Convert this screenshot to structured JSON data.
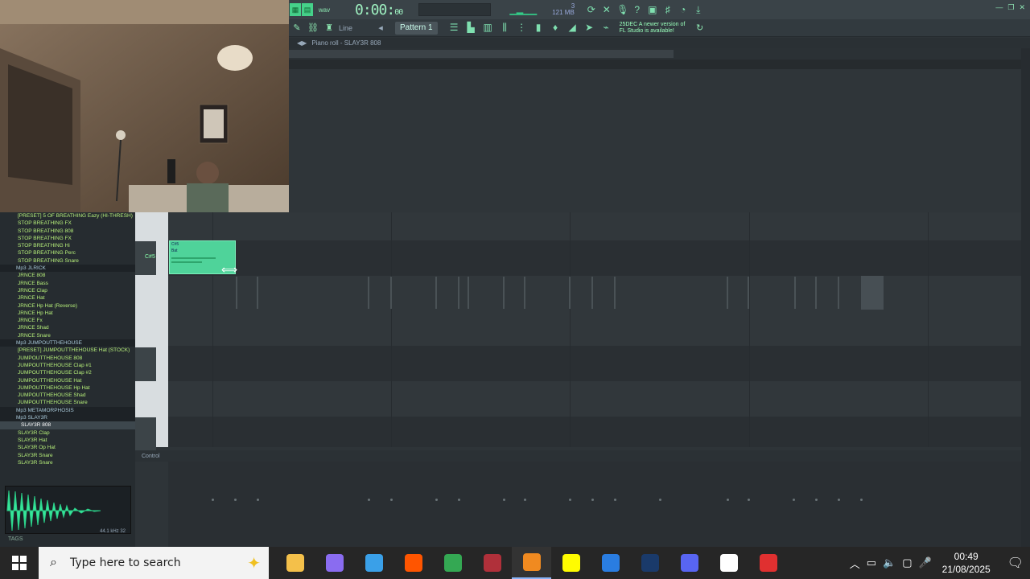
{
  "toolbar": {
    "time_main": "0:00:",
    "time_sub": "00",
    "cpu_line1": "3",
    "cpu_line2": "121 MB",
    "pattern_label": "Pattern 1",
    "snap_label": "Line",
    "hint_line1": "25DEC A newer version of",
    "hint_line2": "FL Studio is available!"
  },
  "piano_roll": {
    "title": "Piano roll - SLAY3R 808",
    "key_label": "C#5",
    "note_label1": "C#5",
    "note_label2": "Bat",
    "control_label": "Control"
  },
  "browser": {
    "items": [
      {
        "label": "[PRESET] 5 OF BREATHING Eazy (HI-THRESH)",
        "kind": "item"
      },
      {
        "label": "STOP BREATHING FX",
        "kind": "item"
      },
      {
        "label": "STOP BREATHING 808",
        "kind": "item"
      },
      {
        "label": "STOP BREATHING FX",
        "kind": "item"
      },
      {
        "label": "STOP BREATHING Hi",
        "kind": "item"
      },
      {
        "label": "STOP BREATHING Perc",
        "kind": "item"
      },
      {
        "label": "STOP BREATHING Snare",
        "kind": "item"
      },
      {
        "label": "Mp3 JLRICK",
        "kind": "folder"
      },
      {
        "label": "JRNCE 808",
        "kind": "item"
      },
      {
        "label": "JRNCE Bass",
        "kind": "item"
      },
      {
        "label": "JRNCE Clap",
        "kind": "item"
      },
      {
        "label": "JRNCE Hat",
        "kind": "item"
      },
      {
        "label": "JRNCE Hp Hat (Reverse)",
        "kind": "item"
      },
      {
        "label": "JRNCE Hp Hat",
        "kind": "item"
      },
      {
        "label": "JRNCE Fx",
        "kind": "item"
      },
      {
        "label": "JRNCE Shad",
        "kind": "item"
      },
      {
        "label": "JRNCE Snare",
        "kind": "item"
      },
      {
        "label": "Mp3 JUMPOUTTHEHOUSE",
        "kind": "folder"
      },
      {
        "label": "[PRESET] JUMPOUTTHEHOUSE Hat (STOCK)",
        "kind": "item"
      },
      {
        "label": "JUMPOUTTHEHOUSE 808",
        "kind": "item"
      },
      {
        "label": "JUMPOUTTHEHOUSE Clap #1",
        "kind": "item"
      },
      {
        "label": "JUMPOUTTHEHOUSE Clap #2",
        "kind": "item"
      },
      {
        "label": "JUMPOUTTHEHOUSE Hat",
        "kind": "item"
      },
      {
        "label": "JUMPOUTTHEHOUSE Hp Hat",
        "kind": "item"
      },
      {
        "label": "JUMPOUTTHEHOUSE Shad",
        "kind": "item"
      },
      {
        "label": "JUMPOUTTHEHOUSE Snare",
        "kind": "item"
      },
      {
        "label": "Mp3 METAMORPHOSIS",
        "kind": "folder"
      },
      {
        "label": "Mp3 SLAY3R",
        "kind": "folder"
      },
      {
        "label": "SLAY3R 808",
        "kind": "selected"
      },
      {
        "label": "SLAY3R Clap",
        "kind": "item"
      },
      {
        "label": "SLAY3R Hat",
        "kind": "item"
      },
      {
        "label": "SLAY3R Op Hat",
        "kind": "item"
      },
      {
        "label": "SLAY3R Snare",
        "kind": "item"
      },
      {
        "label": "SLAY3R Snare",
        "kind": "item"
      }
    ],
    "wave_info": "44.1 kHz 32",
    "tags_label": "TAGS"
  },
  "taskbar": {
    "search_placeholder": "Type here to search",
    "time": "00:49",
    "date": "21/08/2025",
    "apps": [
      {
        "name": "file-explorer-icon",
        "color": "#f4c04a"
      },
      {
        "name": "copilot-icon",
        "color": "#8a6cf0"
      },
      {
        "name": "m365-icon",
        "color": "#3aa0e8"
      },
      {
        "name": "soundcloud-icon",
        "color": "#ff5500"
      },
      {
        "name": "chrome-icon",
        "color": "#34a853"
      },
      {
        "name": "access-icon",
        "color": "#b0303a"
      },
      {
        "name": "fl-studio-icon",
        "color": "#f08a20"
      },
      {
        "name": "snapchat-icon",
        "color": "#fffc00"
      },
      {
        "name": "store-icon",
        "color": "#2a7de1"
      },
      {
        "name": "disney-icon",
        "color": "#1a3a6a"
      },
      {
        "name": "discord-icon",
        "color": "#5865f2"
      },
      {
        "name": "capcut-icon",
        "color": "#ffffff"
      },
      {
        "name": "recorder-icon",
        "color": "#e03030"
      }
    ]
  }
}
